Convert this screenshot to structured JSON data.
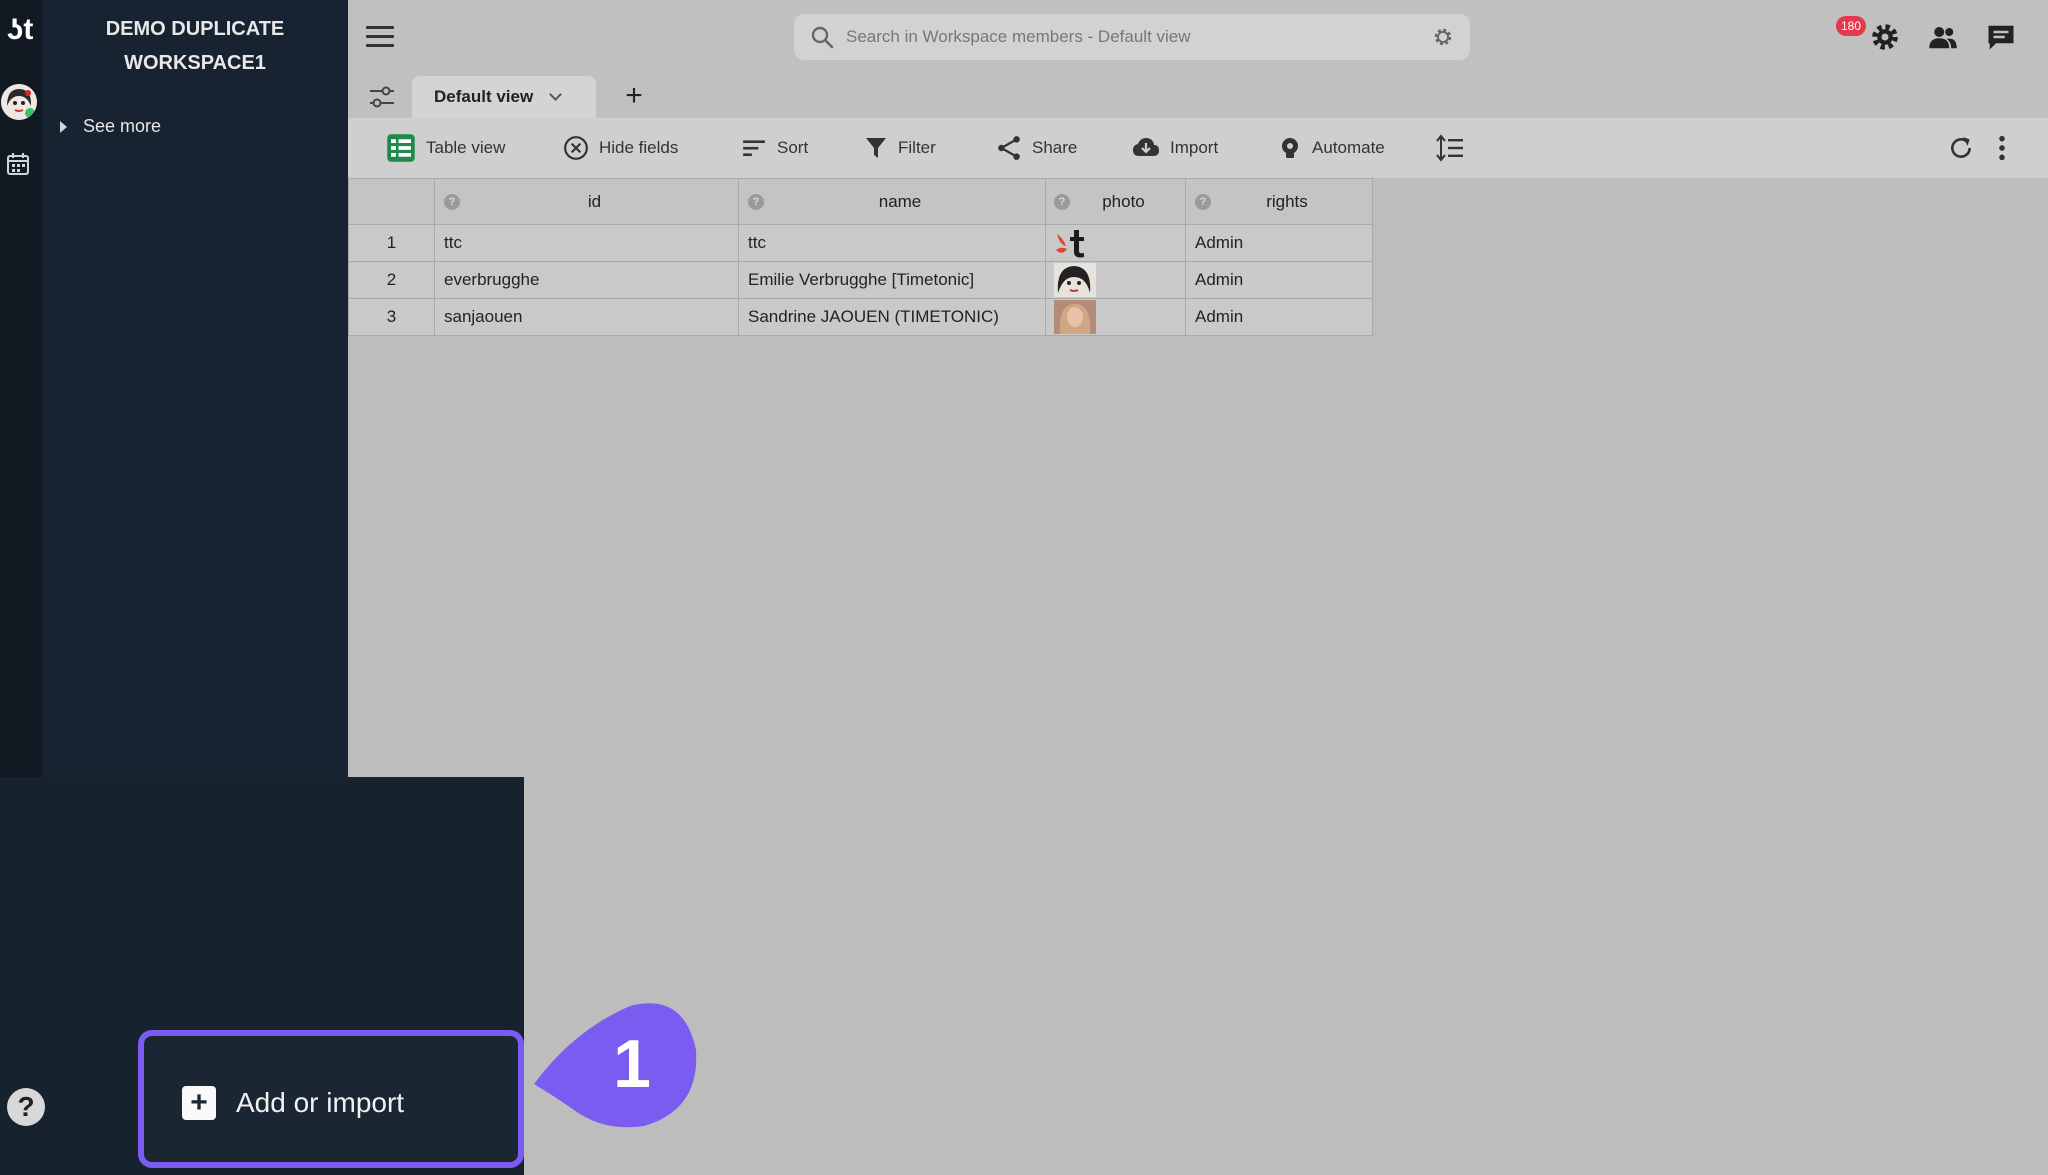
{
  "workspace": {
    "title_line1": "DEMO DUPLICATE",
    "title_line2": "WORKSPACE1"
  },
  "sidebar": {
    "see_more": "See more"
  },
  "search": {
    "placeholder": "Search in Workspace members - Default view"
  },
  "notifications": {
    "count": "180"
  },
  "tabs": [
    {
      "label": "Default view",
      "active": true
    }
  ],
  "toolbar": {
    "table_view": "Table view",
    "hide_fields": "Hide fields",
    "sort": "Sort",
    "filter": "Filter",
    "share": "Share",
    "import": "Import",
    "automate": "Automate"
  },
  "table": {
    "columns": [
      "id",
      "name",
      "photo",
      "rights"
    ],
    "rows": [
      {
        "n": "1",
        "id": "ttc",
        "name": "ttc",
        "rights": "Admin"
      },
      {
        "n": "2",
        "id": "everbrugghe",
        "name": "Emilie Verbrugghe [Timetonic]",
        "rights": "Admin"
      },
      {
        "n": "3",
        "id": "sanjaouen",
        "name": "Sandrine JAOUEN (TIMETONIC)",
        "rights": "Admin"
      }
    ]
  },
  "add_button": {
    "label": "Add or import"
  },
  "step_marker": {
    "number": "1"
  },
  "colors": {
    "highlight": "#7b5cf0",
    "badge": "#e5384d",
    "sidebar": "#172330"
  }
}
